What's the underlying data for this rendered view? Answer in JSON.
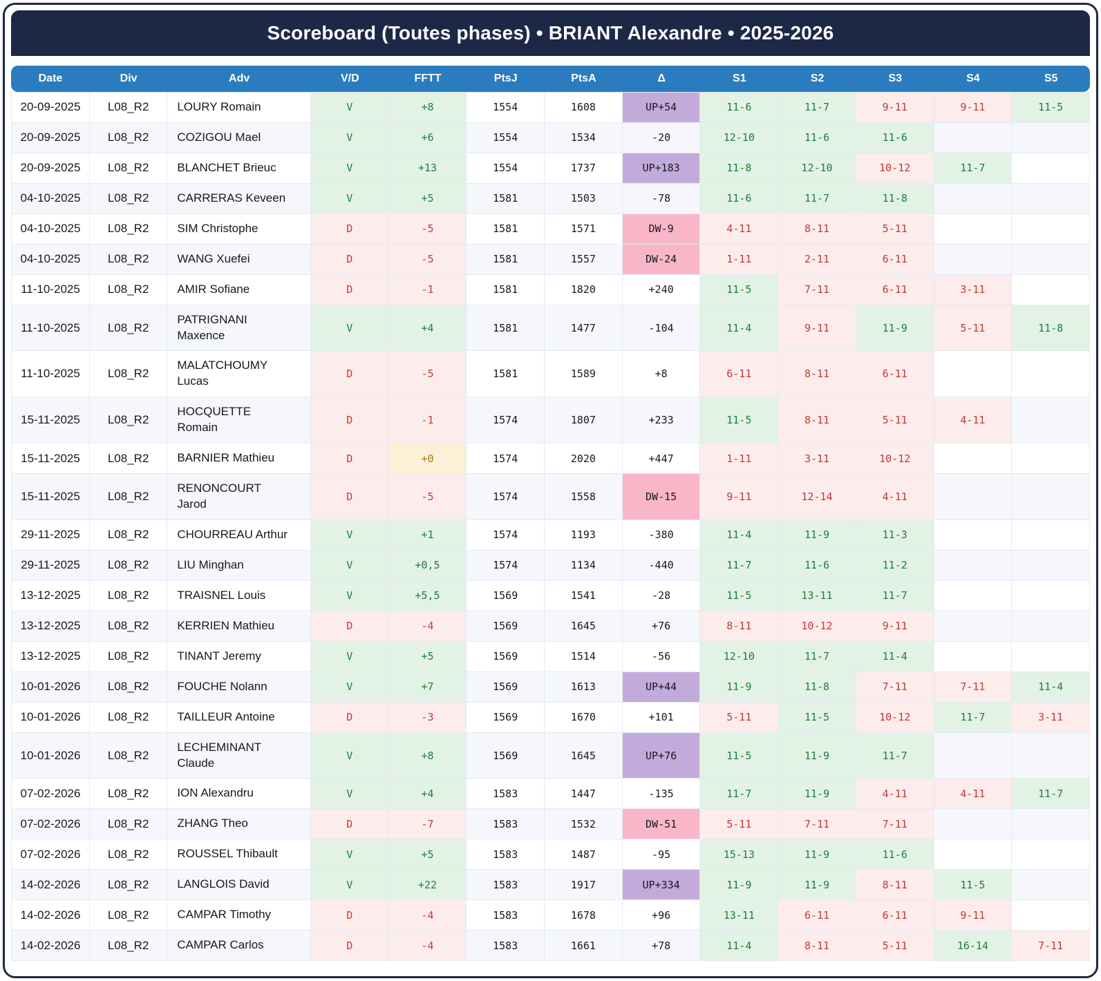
{
  "title": "Scoreboard (Toutes phases) • BRIANT Alexandre • 2025-2026",
  "colors": {
    "frame_navy": "#1c2846",
    "header_blue": "#2a7cbe",
    "row_stripe": "#f5f7fc",
    "win_bg": "#e2f3e5",
    "win_text": "#1f7c38",
    "loss_bg": "#fdecec",
    "loss_text": "#c03a33",
    "zero_bg": "#fcf1d6",
    "zero_text": "#a87b10",
    "delta_up_bg": "#c2abdb",
    "delta_down_bg": "#f9b6c9"
  },
  "table": {
    "columns": [
      "Date",
      "Div",
      "Adv",
      "V/D",
      "FFTT",
      "PtsJ",
      "PtsA",
      "Δ",
      "S1",
      "S2",
      "S3",
      "S4",
      "S5"
    ],
    "rows": [
      {
        "date": "20-09-2025",
        "div": "L08_R2",
        "adv": "LOURY Romain",
        "vd": "V",
        "res": "v",
        "fftt": "+8",
        "fftt_type": "pos",
        "ptsj": "1554",
        "ptsa": "1608",
        "delta": "UP+54",
        "delta_type": "up",
        "sets": [
          [
            "11-6",
            "w"
          ],
          [
            "11-7",
            "w"
          ],
          [
            "9-11",
            "l"
          ],
          [
            "9-11",
            "l"
          ],
          [
            "11-5",
            "w"
          ]
        ]
      },
      {
        "date": "20-09-2025",
        "div": "L08_R2",
        "adv": "COZIGOU Mael",
        "vd": "V",
        "res": "v",
        "fftt": "+6",
        "fftt_type": "pos",
        "ptsj": "1554",
        "ptsa": "1534",
        "delta": "-20",
        "delta_type": "none",
        "sets": [
          [
            "12-10",
            "w"
          ],
          [
            "11-6",
            "w"
          ],
          [
            "11-6",
            "w"
          ]
        ]
      },
      {
        "date": "20-09-2025",
        "div": "L08_R2",
        "adv": "BLANCHET Brieuc",
        "vd": "V",
        "res": "v",
        "fftt": "+13",
        "fftt_type": "pos",
        "ptsj": "1554",
        "ptsa": "1737",
        "delta": "UP+183",
        "delta_type": "up",
        "sets": [
          [
            "11-8",
            "w"
          ],
          [
            "12-10",
            "w"
          ],
          [
            "10-12",
            "l"
          ],
          [
            "11-7",
            "w"
          ]
        ]
      },
      {
        "date": "04-10-2025",
        "div": "L08_R2",
        "adv": "CARRERAS Keveen",
        "vd": "V",
        "res": "v",
        "fftt": "+5",
        "fftt_type": "pos",
        "ptsj": "1581",
        "ptsa": "1503",
        "delta": "-78",
        "delta_type": "none",
        "sets": [
          [
            "11-6",
            "w"
          ],
          [
            "11-7",
            "w"
          ],
          [
            "11-8",
            "w"
          ]
        ]
      },
      {
        "date": "04-10-2025",
        "div": "L08_R2",
        "adv": "SIM Christophe",
        "vd": "D",
        "res": "d",
        "fftt": "-5",
        "fftt_type": "neg",
        "ptsj": "1581",
        "ptsa": "1571",
        "delta": "DW-9",
        "delta_type": "down",
        "sets": [
          [
            "4-11",
            "l"
          ],
          [
            "8-11",
            "l"
          ],
          [
            "5-11",
            "l"
          ]
        ]
      },
      {
        "date": "04-10-2025",
        "div": "L08_R2",
        "adv": "WANG Xuefei",
        "vd": "D",
        "res": "d",
        "fftt": "-5",
        "fftt_type": "neg",
        "ptsj": "1581",
        "ptsa": "1557",
        "delta": "DW-24",
        "delta_type": "down",
        "sets": [
          [
            "1-11",
            "l"
          ],
          [
            "2-11",
            "l"
          ],
          [
            "6-11",
            "l"
          ]
        ]
      },
      {
        "date": "11-10-2025",
        "div": "L08_R2",
        "adv": "AMIR Sofiane",
        "vd": "D",
        "res": "d",
        "fftt": "-1",
        "fftt_type": "neg",
        "ptsj": "1581",
        "ptsa": "1820",
        "delta": "+240",
        "delta_type": "none",
        "sets": [
          [
            "11-5",
            "w"
          ],
          [
            "7-11",
            "l"
          ],
          [
            "6-11",
            "l"
          ],
          [
            "3-11",
            "l"
          ]
        ]
      },
      {
        "date": "11-10-2025",
        "div": "L08_R2",
        "adv": "PATRIGNANI Maxence",
        "vd": "V",
        "res": "v",
        "fftt": "+4",
        "fftt_type": "pos",
        "ptsj": "1581",
        "ptsa": "1477",
        "delta": "-104",
        "delta_type": "none",
        "sets": [
          [
            "11-4",
            "w"
          ],
          [
            "9-11",
            "l"
          ],
          [
            "11-9",
            "w"
          ],
          [
            "5-11",
            "l"
          ],
          [
            "11-8",
            "w"
          ]
        ]
      },
      {
        "date": "11-10-2025",
        "div": "L08_R2",
        "adv": "MALATCHOUMY Lucas",
        "vd": "D",
        "res": "d",
        "fftt": "-5",
        "fftt_type": "neg",
        "ptsj": "1581",
        "ptsa": "1589",
        "delta": "+8",
        "delta_type": "none",
        "sets": [
          [
            "6-11",
            "l"
          ],
          [
            "8-11",
            "l"
          ],
          [
            "6-11",
            "l"
          ]
        ]
      },
      {
        "date": "15-11-2025",
        "div": "L08_R2",
        "adv": "HOCQUETTE Romain",
        "vd": "D",
        "res": "d",
        "fftt": "-1",
        "fftt_type": "neg",
        "ptsj": "1574",
        "ptsa": "1807",
        "delta": "+233",
        "delta_type": "none",
        "sets": [
          [
            "11-5",
            "w"
          ],
          [
            "8-11",
            "l"
          ],
          [
            "5-11",
            "l"
          ],
          [
            "4-11",
            "l"
          ]
        ]
      },
      {
        "date": "15-11-2025",
        "div": "L08_R2",
        "adv": "BARNIER Mathieu",
        "vd": "D",
        "res": "d",
        "fftt": "+0",
        "fftt_type": "zero",
        "ptsj": "1574",
        "ptsa": "2020",
        "delta": "+447",
        "delta_type": "none",
        "sets": [
          [
            "1-11",
            "l"
          ],
          [
            "3-11",
            "l"
          ],
          [
            "10-12",
            "l"
          ]
        ]
      },
      {
        "date": "15-11-2025",
        "div": "L08_R2",
        "adv": "RENONCOURT Jarod",
        "vd": "D",
        "res": "d",
        "fftt": "-5",
        "fftt_type": "neg",
        "ptsj": "1574",
        "ptsa": "1558",
        "delta": "DW-15",
        "delta_type": "down",
        "sets": [
          [
            "9-11",
            "l"
          ],
          [
            "12-14",
            "l"
          ],
          [
            "4-11",
            "l"
          ]
        ]
      },
      {
        "date": "29-11-2025",
        "div": "L08_R2",
        "adv": "CHOURREAU Arthur",
        "vd": "V",
        "res": "v",
        "fftt": "+1",
        "fftt_type": "pos",
        "ptsj": "1574",
        "ptsa": "1193",
        "delta": "-380",
        "delta_type": "none",
        "sets": [
          [
            "11-4",
            "w"
          ],
          [
            "11-9",
            "w"
          ],
          [
            "11-3",
            "w"
          ]
        ]
      },
      {
        "date": "29-11-2025",
        "div": "L08_R2",
        "adv": "LIU Minghan",
        "vd": "V",
        "res": "v",
        "fftt": "+0,5",
        "fftt_type": "pos",
        "ptsj": "1574",
        "ptsa": "1134",
        "delta": "-440",
        "delta_type": "none",
        "sets": [
          [
            "11-7",
            "w"
          ],
          [
            "11-6",
            "w"
          ],
          [
            "11-2",
            "w"
          ]
        ]
      },
      {
        "date": "13-12-2025",
        "div": "L08_R2",
        "adv": "TRAISNEL Louis",
        "vd": "V",
        "res": "v",
        "fftt": "+5,5",
        "fftt_type": "pos",
        "ptsj": "1569",
        "ptsa": "1541",
        "delta": "-28",
        "delta_type": "none",
        "sets": [
          [
            "11-5",
            "w"
          ],
          [
            "13-11",
            "w"
          ],
          [
            "11-7",
            "w"
          ]
        ]
      },
      {
        "date": "13-12-2025",
        "div": "L08_R2",
        "adv": "KERRIEN Mathieu",
        "vd": "D",
        "res": "d",
        "fftt": "-4",
        "fftt_type": "neg",
        "ptsj": "1569",
        "ptsa": "1645",
        "delta": "+76",
        "delta_type": "none",
        "sets": [
          [
            "8-11",
            "l"
          ],
          [
            "10-12",
            "l"
          ],
          [
            "9-11",
            "l"
          ]
        ]
      },
      {
        "date": "13-12-2025",
        "div": "L08_R2",
        "adv": "TINANT Jeremy",
        "vd": "V",
        "res": "v",
        "fftt": "+5",
        "fftt_type": "pos",
        "ptsj": "1569",
        "ptsa": "1514",
        "delta": "-56",
        "delta_type": "none",
        "sets": [
          [
            "12-10",
            "w"
          ],
          [
            "11-7",
            "w"
          ],
          [
            "11-4",
            "w"
          ]
        ]
      },
      {
        "date": "10-01-2026",
        "div": "L08_R2",
        "adv": "FOUCHE Nolann",
        "vd": "V",
        "res": "v",
        "fftt": "+7",
        "fftt_type": "pos",
        "ptsj": "1569",
        "ptsa": "1613",
        "delta": "UP+44",
        "delta_type": "up",
        "sets": [
          [
            "11-9",
            "w"
          ],
          [
            "11-8",
            "w"
          ],
          [
            "7-11",
            "l"
          ],
          [
            "7-11",
            "l"
          ],
          [
            "11-4",
            "w"
          ]
        ]
      },
      {
        "date": "10-01-2026",
        "div": "L08_R2",
        "adv": "TAILLEUR Antoine",
        "vd": "D",
        "res": "d",
        "fftt": "-3",
        "fftt_type": "neg",
        "ptsj": "1569",
        "ptsa": "1670",
        "delta": "+101",
        "delta_type": "none",
        "sets": [
          [
            "5-11",
            "l"
          ],
          [
            "11-5",
            "w"
          ],
          [
            "10-12",
            "l"
          ],
          [
            "11-7",
            "w"
          ],
          [
            "3-11",
            "l"
          ]
        ]
      },
      {
        "date": "10-01-2026",
        "div": "L08_R2",
        "adv": "LECHEMINANT Claude",
        "vd": "V",
        "res": "v",
        "fftt": "+8",
        "fftt_type": "pos",
        "ptsj": "1569",
        "ptsa": "1645",
        "delta": "UP+76",
        "delta_type": "up",
        "sets": [
          [
            "11-5",
            "w"
          ],
          [
            "11-9",
            "w"
          ],
          [
            "11-7",
            "w"
          ]
        ]
      },
      {
        "date": "07-02-2026",
        "div": "L08_R2",
        "adv": "ION Alexandru",
        "vd": "V",
        "res": "v",
        "fftt": "+4",
        "fftt_type": "pos",
        "ptsj": "1583",
        "ptsa": "1447",
        "delta": "-135",
        "delta_type": "none",
        "sets": [
          [
            "11-7",
            "w"
          ],
          [
            "11-9",
            "w"
          ],
          [
            "4-11",
            "l"
          ],
          [
            "4-11",
            "l"
          ],
          [
            "11-7",
            "w"
          ]
        ]
      },
      {
        "date": "07-02-2026",
        "div": "L08_R2",
        "adv": "ZHANG Theo",
        "vd": "D",
        "res": "d",
        "fftt": "-7",
        "fftt_type": "neg",
        "ptsj": "1583",
        "ptsa": "1532",
        "delta": "DW-51",
        "delta_type": "down",
        "sets": [
          [
            "5-11",
            "l"
          ],
          [
            "7-11",
            "l"
          ],
          [
            "7-11",
            "l"
          ]
        ]
      },
      {
        "date": "07-02-2026",
        "div": "L08_R2",
        "adv": "ROUSSEL Thibault",
        "vd": "V",
        "res": "v",
        "fftt": "+5",
        "fftt_type": "pos",
        "ptsj": "1583",
        "ptsa": "1487",
        "delta": "-95",
        "delta_type": "none",
        "sets": [
          [
            "15-13",
            "w"
          ],
          [
            "11-9",
            "w"
          ],
          [
            "11-6",
            "w"
          ]
        ]
      },
      {
        "date": "14-02-2026",
        "div": "L08_R2",
        "adv": "LANGLOIS David",
        "vd": "V",
        "res": "v",
        "fftt": "+22",
        "fftt_type": "pos",
        "ptsj": "1583",
        "ptsa": "1917",
        "delta": "UP+334",
        "delta_type": "up",
        "sets": [
          [
            "11-9",
            "w"
          ],
          [
            "11-9",
            "w"
          ],
          [
            "8-11",
            "l"
          ],
          [
            "11-5",
            "w"
          ]
        ]
      },
      {
        "date": "14-02-2026",
        "div": "L08_R2",
        "adv": "CAMPAR Timothy",
        "vd": "D",
        "res": "d",
        "fftt": "-4",
        "fftt_type": "neg",
        "ptsj": "1583",
        "ptsa": "1678",
        "delta": "+96",
        "delta_type": "none",
        "sets": [
          [
            "13-11",
            "w"
          ],
          [
            "6-11",
            "l"
          ],
          [
            "6-11",
            "l"
          ],
          [
            "9-11",
            "l"
          ]
        ]
      },
      {
        "date": "14-02-2026",
        "div": "L08_R2",
        "adv": "CAMPAR Carlos",
        "vd": "D",
        "res": "d",
        "fftt": "-4",
        "fftt_type": "neg",
        "ptsj": "1583",
        "ptsa": "1661",
        "delta": "+78",
        "delta_type": "none",
        "sets": [
          [
            "11-4",
            "w"
          ],
          [
            "8-11",
            "l"
          ],
          [
            "5-11",
            "l"
          ],
          [
            "16-14",
            "w"
          ],
          [
            "7-11",
            "l"
          ]
        ]
      }
    ]
  }
}
